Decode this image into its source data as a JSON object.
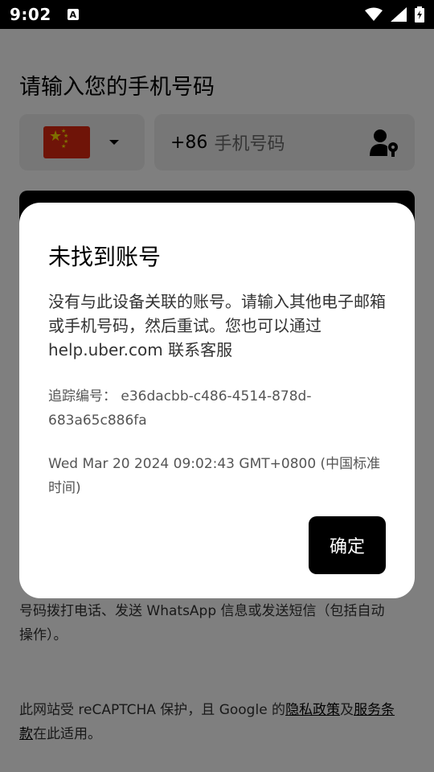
{
  "status_bar": {
    "time": "9:02",
    "icons": [
      "app-notification-icon",
      "wifi-icon",
      "signal-icon",
      "battery-icon"
    ]
  },
  "page": {
    "title": "请输入您的手机号码",
    "country_code": "+86",
    "phone_placeholder": "手机号码",
    "consent_text": "号码拨打电话、发送 WhatsApp 信息或发送短信（包括自动操作）。",
    "recaptcha_prefix": "此网站受 reCAPTCHA 保护，且 Google 的",
    "privacy_link": "隐私政策",
    "and_text": "及",
    "terms_link": "服务条款",
    "recaptcha_suffix": "在此适用。"
  },
  "dialog": {
    "title": "未找到账号",
    "body": "没有与此设备关联的账号。请输入其他电子邮箱或手机号码，然后重试。您也可以通过 help.uber.com 联系客服",
    "tracking": "追踪编号： e36dacbb-c486-4514-878d-683a65c886fa",
    "timestamp": "Wed Mar 20 2024 09:02:43 GMT+0800 (中国标准时间)",
    "confirm_label": "确定"
  },
  "colors": {
    "flag_red": "#de2910",
    "flag_star": "#ffde00",
    "field_bg": "#eeeeee",
    "primary": "#000000"
  }
}
